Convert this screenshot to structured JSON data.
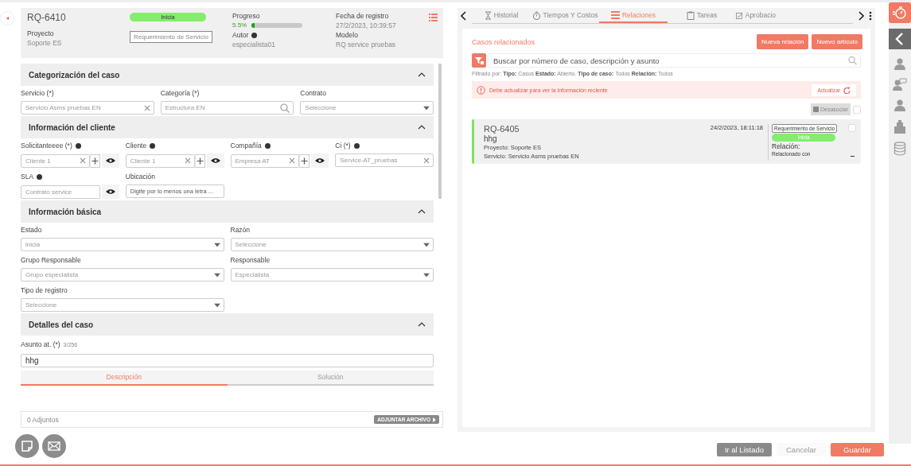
{
  "header": {
    "case_id": "RQ-6410",
    "status": "Inicia",
    "case_type": "Requerimiento de Servicio",
    "project": {
      "label": "Proyecto",
      "value": "Soporte ES"
    },
    "progress": {
      "label": "Progreso",
      "reading": "5.5%",
      "level": 0.055
    },
    "author": {
      "label": "Autor",
      "value": "especialista01"
    },
    "date": {
      "label": "Fecha de registro",
      "value": "27/2/2023, 10:39:57"
    },
    "model": {
      "label": "Modelo",
      "value": "RQ service pruebas"
    }
  },
  "sections": [
    {
      "title": "Categorización del caso",
      "expanded": true,
      "rows": [
        [
          {
            "label": "Servicio (*)",
            "info": false,
            "kind": "clear",
            "value": "Servicio Asms pruebas EN"
          },
          {
            "label": "Categoría (*)",
            "info": false,
            "kind": "search",
            "value": "Estructura EN"
          },
          {
            "label": "Contrato",
            "info": false,
            "kind": "select",
            "placeholder": "Seleccione"
          }
        ]
      ]
    },
    {
      "title": "Información del cliente",
      "expanded": true,
      "rows": [
        [
          {
            "label": "Solicitanteeee (*)",
            "info": true,
            "kind": "lookup",
            "value": "Cliente 1"
          },
          {
            "label": "Cliente",
            "info": true,
            "kind": "lookup",
            "value": "Cliente 1"
          },
          {
            "label": "Compañía",
            "info": true,
            "kind": "lookup",
            "value": "Empresa AT"
          },
          {
            "label": "Ci (*)",
            "info": true,
            "kind": "clear",
            "value": "Service-AT_pruebas"
          }
        ],
        [
          {
            "label": "SLA",
            "info": true,
            "kind": "view",
            "placeholder": "Contrato service"
          },
          {
            "label": "Ubicación",
            "info": false,
            "kind": "text",
            "placeholder": "Digite por lo menos una letra ..."
          }
        ]
      ]
    },
    {
      "title": "Información básica",
      "expanded": true,
      "rows": [
        [
          {
            "label": "Estado",
            "info": false,
            "kind": "select",
            "value": "inicia"
          },
          {
            "label": "Razón",
            "info": false,
            "kind": "select",
            "placeholder": "Seleccione"
          }
        ],
        [
          {
            "label": "Grupo Responsable",
            "info": false,
            "kind": "select",
            "value": "Grupo especialista"
          },
          {
            "label": "Responsable",
            "info": false,
            "kind": "select",
            "value": "Especialista"
          }
        ],
        [
          {
            "label": "Tipo de registro",
            "info": false,
            "kind": "select",
            "placeholder": "Seleccione"
          }
        ]
      ]
    }
  ],
  "details": {
    "title": "Detalles del caso",
    "expanded": true,
    "subject_label": "Asunto at. (*)",
    "subject_counter": "3/256",
    "subject": "hhg",
    "tabs": [
      {
        "label": "Descripción",
        "selected": true
      },
      {
        "label": "Solución",
        "selected": false
      }
    ]
  },
  "attachments": {
    "count": "0 Adjuntos",
    "button": "ADJUNTAR ARCHIVO"
  },
  "panel_tabs": [
    {
      "label": "Historial",
      "selected": false
    },
    {
      "label": "Tiempos Y Costos",
      "selected": false
    },
    {
      "label": "Relaciones",
      "selected": true
    },
    {
      "label": "Tareas",
      "selected": false
    },
    {
      "label": "Aprobacio",
      "selected": false
    }
  ],
  "relations": {
    "title": "Casos relacionados",
    "buttons": [
      "Nueva relación",
      "Nuevo artículo"
    ],
    "search": {
      "placeholder": "Buscar por número de caso, descripción y asunto"
    },
    "filter": "Filtrado por: **Tipo:** Casos **Estado:** Abierto. **Tipo de caso:** Todos **Relación:** Todos",
    "alert": "Debe actualizar para ver la información reciente",
    "refresh": "Actualizar",
    "unlink": {
      "label": "Desasociar",
      "disabled": true
    },
    "select_all": {
      "checked": false
    },
    "cases": [
      {
        "id": "RQ-6405",
        "date": "24/2/2023, 18:11:18",
        "subject": "hhg",
        "project": "Proyecto: Soporte ES",
        "service": "Servicio: Servicio Asms pruebas EN",
        "case_type": "Requerimiento de Servicio",
        "status": "Inicia",
        "relation_label": "Relación:",
        "relation": "Relacionado con",
        "checked": false
      }
    ]
  },
  "footer": {
    "buttons": [
      {
        "label": "Ir al Listado",
        "kind": "secondary"
      },
      {
        "label": "Cancelar",
        "kind": "plain"
      },
      {
        "label": "Guardar",
        "kind": "primary"
      }
    ]
  }
}
